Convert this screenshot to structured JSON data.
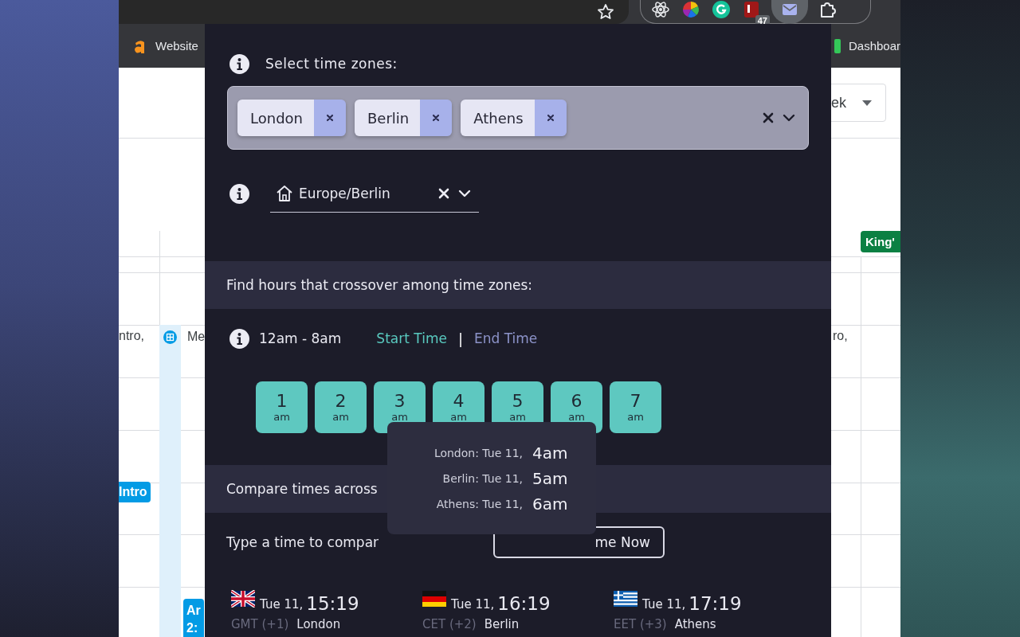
{
  "browser": {
    "toolbar_badge": "47",
    "bookmarks": [
      {
        "label": "Website",
        "kind": "orange"
      },
      {
        "label": "Dashboar",
        "kind": "green"
      }
    ]
  },
  "calendar": {
    "view_dropdown": "ek",
    "events": [
      {
        "kind": "plain",
        "text": "ntro,"
      },
      {
        "kind": "bar",
        "text": "Me",
        "color": "#dff0fb"
      },
      {
        "kind": "chip",
        "text": "Intro",
        "color": "#039be5"
      },
      {
        "kind": "chip",
        "text": "Ar",
        "subtext": "2:",
        "color": "#039be5"
      },
      {
        "kind": "chip",
        "text": "King'",
        "color": "#0b8043"
      },
      {
        "kind": "plain",
        "text": "ro,"
      }
    ]
  },
  "time_zones": {
    "title": "Select time zones:",
    "chips": [
      {
        "label": "London"
      },
      {
        "label": "Berlin"
      },
      {
        "label": "Athens"
      }
    ],
    "home_zone": "Europe/Berlin"
  },
  "crossover": {
    "title": "Find hours that crossover among time zones:",
    "range": "12am - 8am",
    "modes": [
      {
        "label": "Start Time",
        "selected": true
      },
      {
        "label": "End Time",
        "selected": false
      }
    ],
    "separator": "|",
    "hours": [
      {
        "hour": "1",
        "period": "am"
      },
      {
        "hour": "2",
        "period": "am"
      },
      {
        "hour": "3",
        "period": "am"
      },
      {
        "hour": "4",
        "period": "am"
      },
      {
        "hour": "5",
        "period": "am"
      },
      {
        "hour": "6",
        "period": "am"
      },
      {
        "hour": "7",
        "period": "am"
      }
    ],
    "tooltip": [
      {
        "label": "London: Tue 11,",
        "time": "4am"
      },
      {
        "label": "Berlin: Tue 11,",
        "time": "5am"
      },
      {
        "label": "Athens: Tue 11,",
        "time": "6am"
      }
    ]
  },
  "compare": {
    "title": "Compare times across",
    "prompt": "Type a time to compar",
    "button": "me Now",
    "clocks": [
      {
        "kind": "uk",
        "date": "Tue 11,",
        "time": "15:19",
        "abbr": "GMT",
        "offset": "(+1)",
        "city": "London"
      },
      {
        "kind": "de",
        "date": "Tue 11,",
        "time": "16:19",
        "abbr": "CET",
        "offset": "(+2)",
        "city": "Berlin"
      },
      {
        "kind": "gr",
        "date": "Tue 11,",
        "time": "17:19",
        "abbr": "EET",
        "offset": "(+3)",
        "city": "Athens"
      }
    ]
  }
}
